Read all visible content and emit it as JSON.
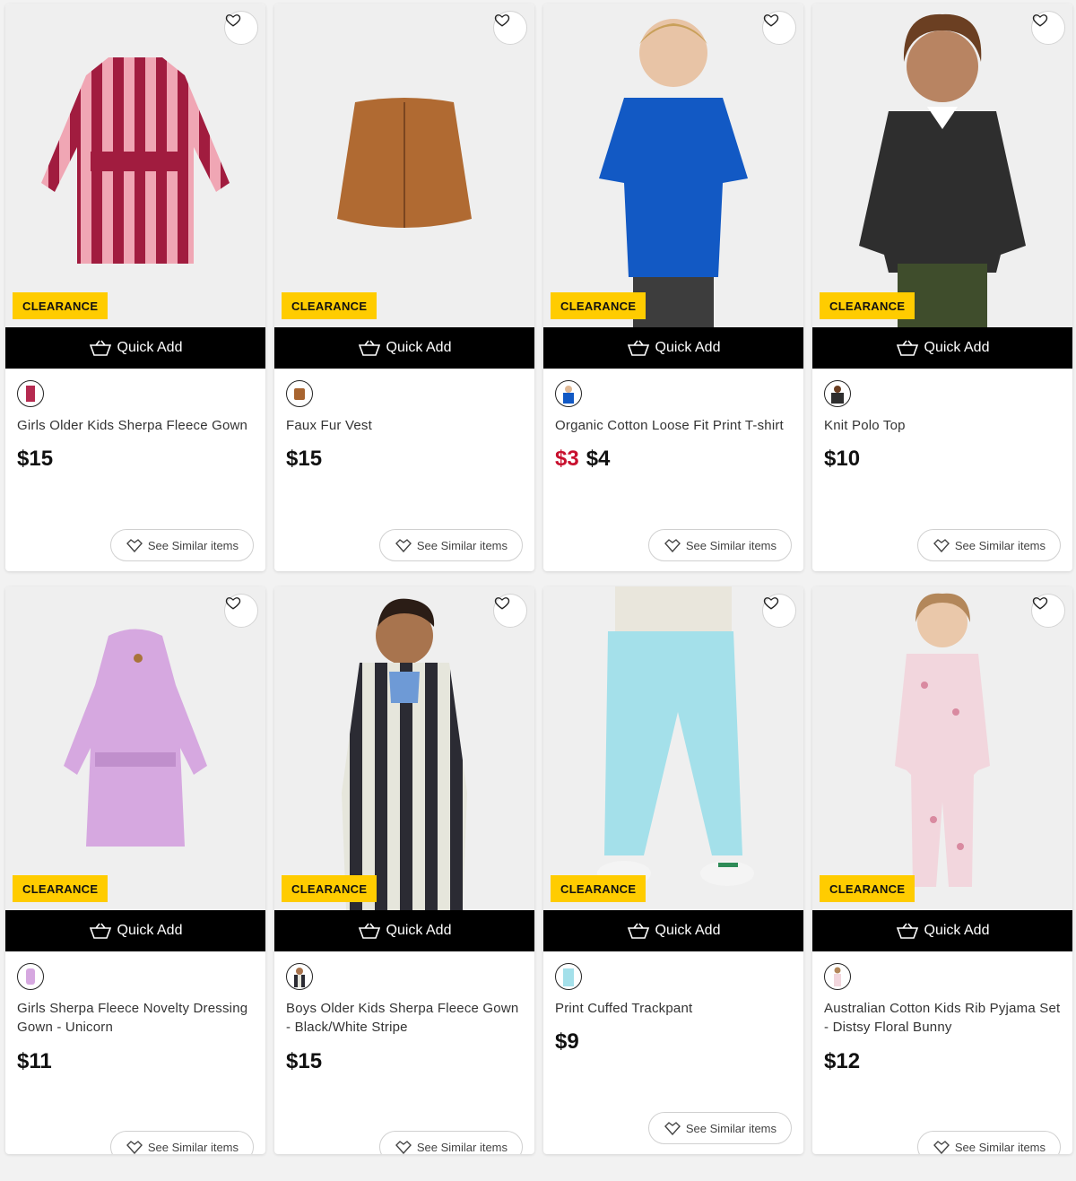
{
  "labels": {
    "clearance": "CLEARANCE",
    "quick_add": "Quick Add",
    "see_similar": "See Similar items"
  },
  "colors": {
    "badge": "#ffcc00",
    "quick_add_bg": "#000000",
    "sale_price": "#c8102e"
  },
  "products": [
    {
      "name": "Girls Older Kids Sherpa Fleece Gown",
      "price": "$15",
      "sale_price": ""
    },
    {
      "name": "Faux Fur Vest",
      "price": "$15",
      "sale_price": ""
    },
    {
      "name": "Organic Cotton Loose Fit Print T-shirt",
      "price": "$4",
      "sale_price": "$3"
    },
    {
      "name": "Knit Polo Top",
      "price": "$10",
      "sale_price": ""
    },
    {
      "name": "Girls Sherpa Fleece Novelty Dressing Gown - Unicorn",
      "price": "$11",
      "sale_price": ""
    },
    {
      "name": "Boys Older Kids Sherpa Fleece Gown - Black/White Stripe",
      "price": "$15",
      "sale_price": ""
    },
    {
      "name": "Print Cuffed Trackpant",
      "price": "$9",
      "sale_price": ""
    },
    {
      "name": "Australian Cotton Kids Rib Pyjama Set - Distsy Floral Bunny",
      "price": "$12",
      "sale_price": ""
    }
  ]
}
